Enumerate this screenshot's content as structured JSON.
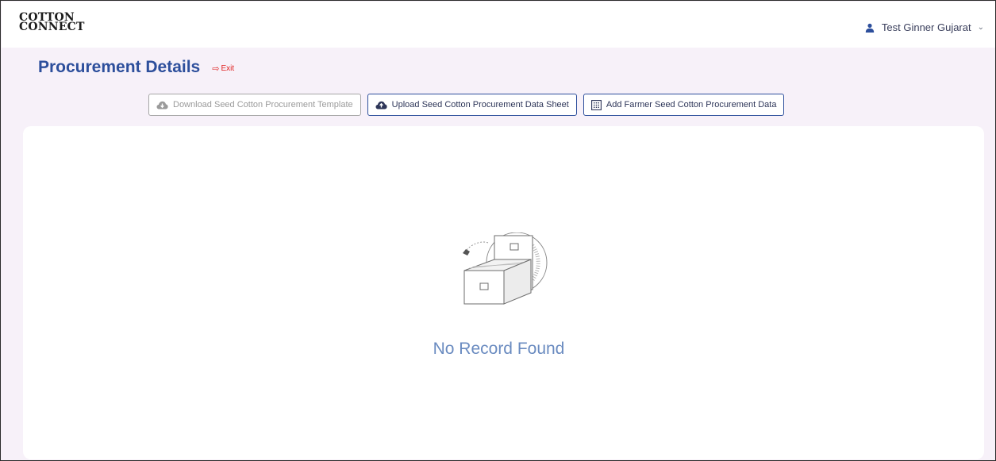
{
  "logo": {
    "line1": "COTTON",
    "line2": "CONNECT"
  },
  "user": {
    "name": "Test Ginner Gujarat",
    "icon": "user-icon"
  },
  "page": {
    "title": "Procurement Details",
    "exit_label": "Exit"
  },
  "actions": [
    {
      "label": "Download Seed Cotton Procurement Template",
      "icon": "cloud-download-icon",
      "state": "disabled"
    },
    {
      "label": "Upload Seed Cotton Procurement Data Sheet",
      "icon": "cloud-upload-icon",
      "state": "enabled"
    },
    {
      "label": "Add Farmer Seed Cotton Procurement Data",
      "icon": "grid-icon",
      "state": "enabled"
    }
  ],
  "empty_state": {
    "message": "No Record Found",
    "icon": "file-cabinet-icon"
  },
  "colors": {
    "primary": "#2d4f9c",
    "danger": "#e02424",
    "empty_text": "#6a8bc0",
    "page_bg": "#f7f1f9"
  }
}
